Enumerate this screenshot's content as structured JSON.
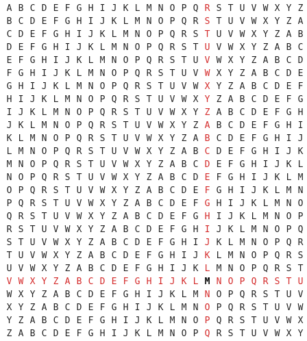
{
  "grid": {
    "rows": [
      "ABCDEFGHIJKLMNOPQRSTUVWXYZ",
      "BCDEFGHIJKLMNOPQRSTUVWXYZA",
      "CDEFGHIJKLMNOPQRSTUVWXYZAB",
      "DEFGHIJKLMNOPQRSTUVWXYZABC",
      "EFGHIJKLMNOPQRSTUVWXYZABCD",
      "FGHIJKLMNOPQRSTUVWXYZABCDE",
      "GHIJKLMNOPQRSTUVWXYZABCDEF",
      "HIJKLMNOPQRSTUVWXYZABCDEFG",
      "IJKLMNOPQRSTUVWXYZABCDEFGH",
      "JKLMNOPQRSTUVWXYZABCDEFGHI",
      "KLMNOPQRSTUVWXYZABCDEFGHIJ",
      "LMNOPQRSTUVWXYZABCDEFGHIJK",
      "MNOPQRSTUVWXYZABCDEFGHIJKL",
      "NOPQRSTUVWXYZABCDEFGHIJKLM",
      "OPQRSTUVWXYZABCDEFGHIJKLMN",
      "PQRSTUVWXYZABCDEFGHIJKLMNO",
      "QRSTUVWXYZABCDEFGHIJKLMNOP",
      "RSTUVWXYZABCDEFGHIJKLMNOPQ",
      "STUVWXYZABCDEFGHIJKLMNOPQR",
      "TUVWXYZABCDEFGHIJKLMNOPQRS",
      "UVWXYZABCDEFGHIJKLMNOPQRST",
      "VWXYZABCDEFGHIJKLMNOPQRSTU",
      "WXYZABCDEFGHIJKLMNOPQRSTUV",
      "XYZABCDEFGHIJKLMNOPQRSTUVW",
      "YZABCDEFGHIJKLMNOPQRSTUVWX",
      "ZABCDEFGHIJKLMNOPQRSTUVWXY"
    ],
    "highlight_row": 21,
    "highlight_col": 17,
    "colors": {
      "text": "#222222",
      "highlight": "#d42a2a",
      "intersection": "#000000"
    }
  }
}
